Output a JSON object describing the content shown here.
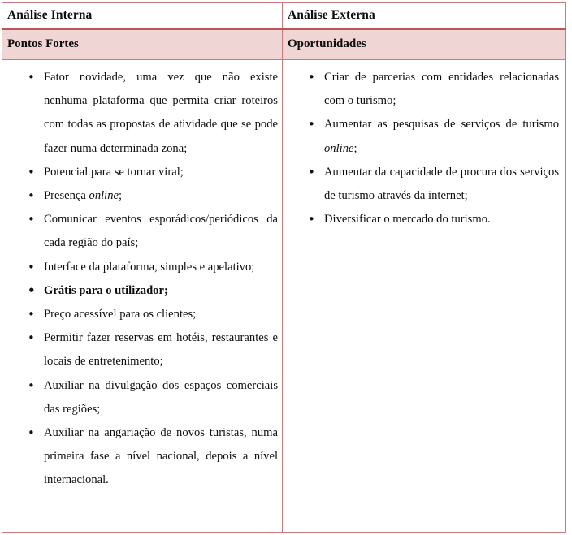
{
  "table": {
    "headers": [
      {
        "label": "Análise Interna"
      },
      {
        "label": "Análise Externa"
      }
    ],
    "subheaders": [
      {
        "label": "Pontos Fortes"
      },
      {
        "label": "Oportunidades"
      }
    ],
    "columns": [
      {
        "name": "pontos-fortes",
        "items": [
          {
            "text": "Fator novidade, uma vez que não existe nenhuma plataforma que permita criar roteiros com todas as propostas de atividade que se pode fazer numa determinada zona;",
            "bold": false
          },
          {
            "text": "Potencial para se tornar viral;",
            "bold": false
          },
          {
            "text": "Presença online;",
            "bold": false,
            "italic_word": "online"
          },
          {
            "text": "Comunicar eventos esporádicos/periódicos da cada região do país;",
            "bold": false
          },
          {
            "text": "Interface da plataforma, simples e apelativo;",
            "bold": false
          },
          {
            "text": "Grátis para o utilizador;",
            "bold": true
          },
          {
            "text": "Preço acessível para os clientes;",
            "bold": false
          },
          {
            "text": "Permitir fazer reservas em hotéis, restaurantes e locais de entretenimento;",
            "bold": false
          },
          {
            "text": "Auxiliar na divulgação dos espaços comerciais das regiões;",
            "bold": false
          },
          {
            "text": "Auxiliar na angariação de novos turistas, numa primeira fase a nível nacional, depois a nível internacional.",
            "bold": false
          }
        ]
      },
      {
        "name": "oportunidades",
        "items": [
          {
            "text": "Criar de parcerias com entidades relacionadas com o turismo;",
            "bold": false
          },
          {
            "text": "Aumentar as pesquisas de serviços de turismo online;",
            "bold": false,
            "italic_word": "online"
          },
          {
            "text": "Aumentar da capacidade de procura dos serviços de turismo através da internet;",
            "bold": false
          },
          {
            "text": "Diversificar o mercado do turismo.",
            "bold": false
          }
        ]
      }
    ]
  },
  "colors": {
    "border": "#c9797b",
    "border_accent": "#bd5356",
    "subheader_background": "#efd5d3",
    "text": "#0d0d0d",
    "page_background": "#ffffff"
  }
}
